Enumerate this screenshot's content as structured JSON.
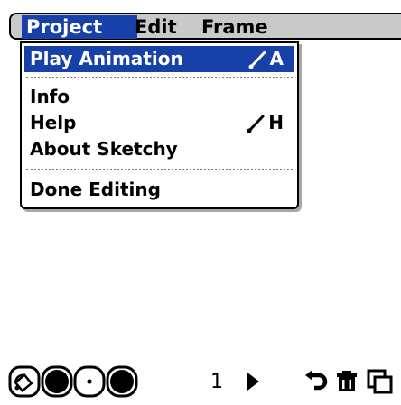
{
  "menubar": {
    "menus": [
      "Project",
      "Edit",
      "Frame"
    ],
    "active_menu": "Project"
  },
  "dropdown": {
    "play_animation": {
      "label": "Play Animation",
      "shortcut_key": "A"
    },
    "info": {
      "label": "Info"
    },
    "help": {
      "label": "Help",
      "shortcut_key": "H"
    },
    "about": {
      "label": "About Sketchy"
    },
    "done_editing": {
      "label": "Done Editing"
    }
  },
  "toolbar": {
    "frame_number": "1",
    "tools": [
      "fill-tool-icon",
      "large-brush-icon",
      "small-brush-icon",
      "color-icon",
      "next-frame-icon",
      "undo-icon",
      "trash-icon",
      "copy-frame-icon"
    ]
  },
  "colors": {
    "highlight": "#1740a8",
    "menubar_bg": "#c9c9c9",
    "divider": "#7a7a7a"
  }
}
